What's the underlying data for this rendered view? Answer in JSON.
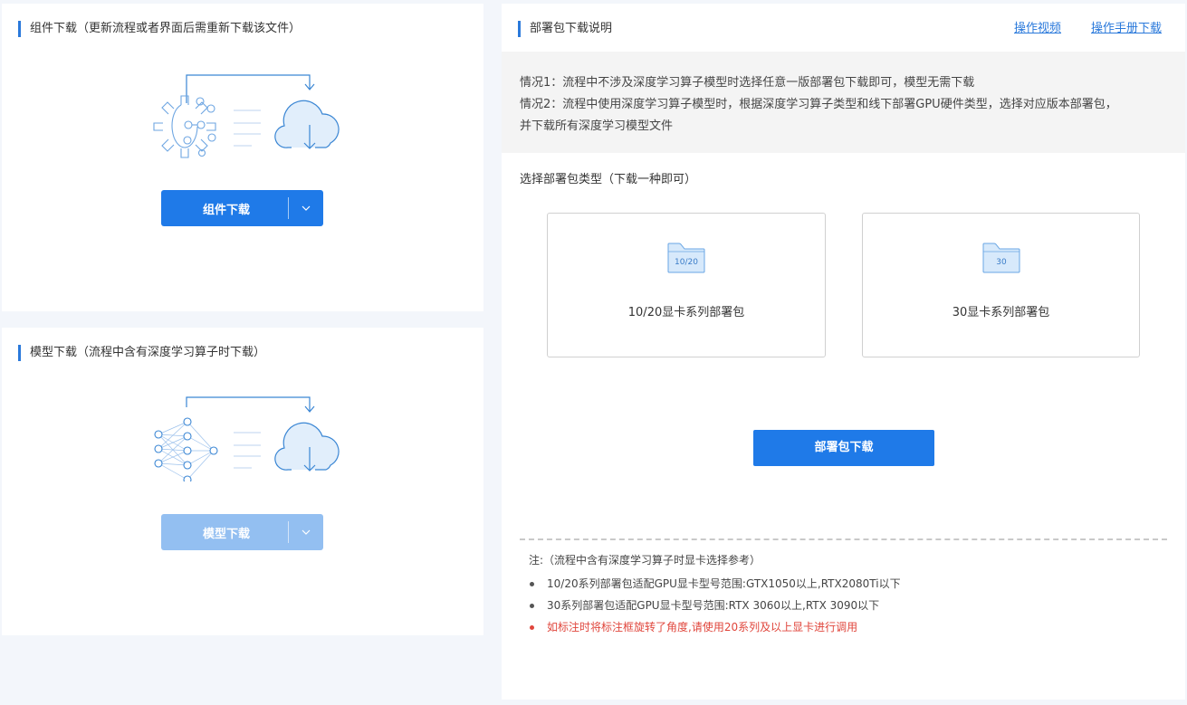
{
  "component": {
    "title": "组件下载（更新流程或者界面后需重新下载该文件）",
    "button_label": "组件下载"
  },
  "model": {
    "title": "模型下载（流程中含有深度学习算子时下载）",
    "button_label": "模型下载"
  },
  "deploy": {
    "title": "部署包下载说明",
    "links": {
      "video": "操作视频",
      "manual": "操作手册下载"
    },
    "info": [
      "情况1：流程中不涉及深度学习算子模型时选择任意一版部署包下载即可，模型无需下载",
      "情况2：流程中使用深度学习算子模型时，根据深度学习算子类型和线下部署GPU硬件类型，选择对应版本部署包，",
      "并下载所有深度学习模型文件"
    ],
    "select_title": "选择部署包类型（下载一种即可）",
    "cards": [
      {
        "icon_label": "10/20",
        "label": "10/20显卡系列部署包",
        "icon": "folder-icon"
      },
      {
        "icon_label": "30",
        "label": "30显卡系列部署包",
        "icon": "folder-icon"
      }
    ],
    "download_label": "部署包下载",
    "notes": {
      "title": "注:（流程中含有深度学习算子时显卡选择参考）",
      "items": [
        "10/20系列部署包适配GPU显卡型号范围:GTX1050以上,RTX2080Ti以下",
        "30系列部署包适配GPU显卡型号范围:RTX 3060以上,RTX 3090以下",
        "如标注时将标注框旋转了角度,请使用20系列及以上显卡进行调用"
      ]
    }
  },
  "colors": {
    "primary": "#1f7ae8",
    "primary_disabled": "#93bff1",
    "warning": "#e0463c",
    "accent_bar": "#2a79db"
  }
}
